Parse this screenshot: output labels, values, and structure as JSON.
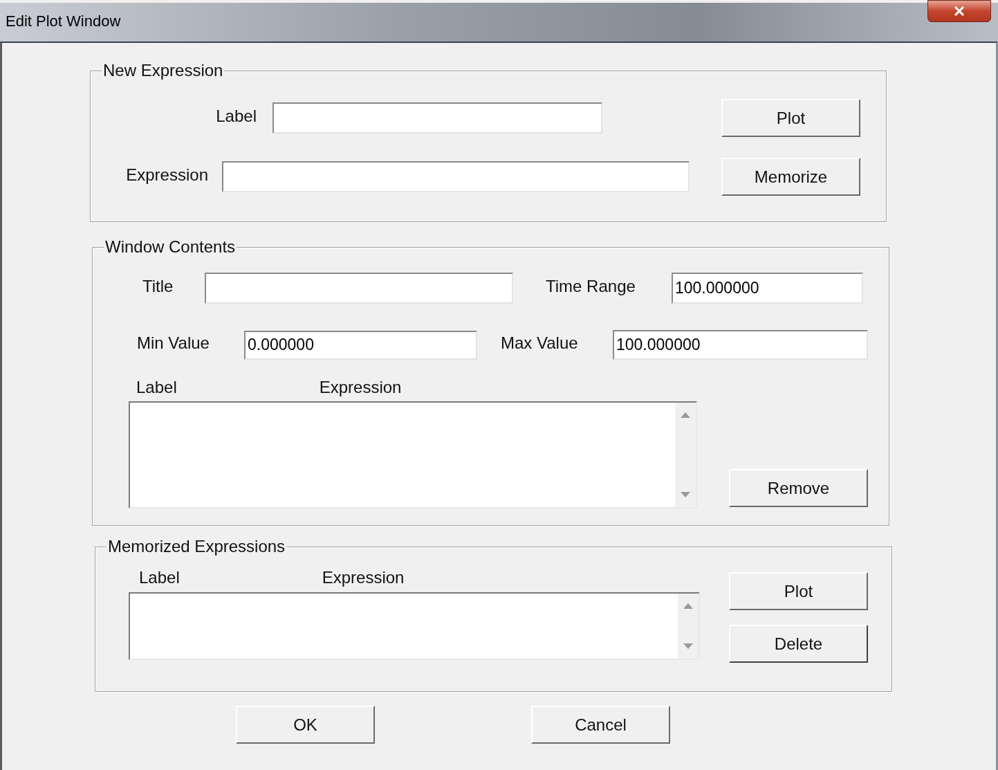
{
  "window": {
    "title": "Edit Plot Window"
  },
  "new_expression": {
    "title": "New Expression",
    "fields": [
      {
        "label": "Label"
      },
      {
        "label": "Expression"
      }
    ],
    "buttons": [
      "Plot",
      "Memorize"
    ]
  },
  "window_contents": {
    "title": "Window Contents",
    "fields": [
      {
        "label": "Title"
      },
      {
        "label": "Time Range",
        "value": "100.000000"
      },
      {
        "label": "Min Value",
        "value": "0.000000"
      },
      {
        "label": "Max Value",
        "value": "100.000000"
      }
    ],
    "list_columns": [
      "Label",
      "Expression"
    ],
    "buttons": [
      "Remove"
    ]
  },
  "memorized": {
    "title": "Memorized Expressions",
    "list_columns": [
      "Label",
      "Expression"
    ],
    "buttons": [
      "Plot",
      "Delete"
    ]
  },
  "footer_buttons": [
    "OK",
    "Cancel"
  ]
}
